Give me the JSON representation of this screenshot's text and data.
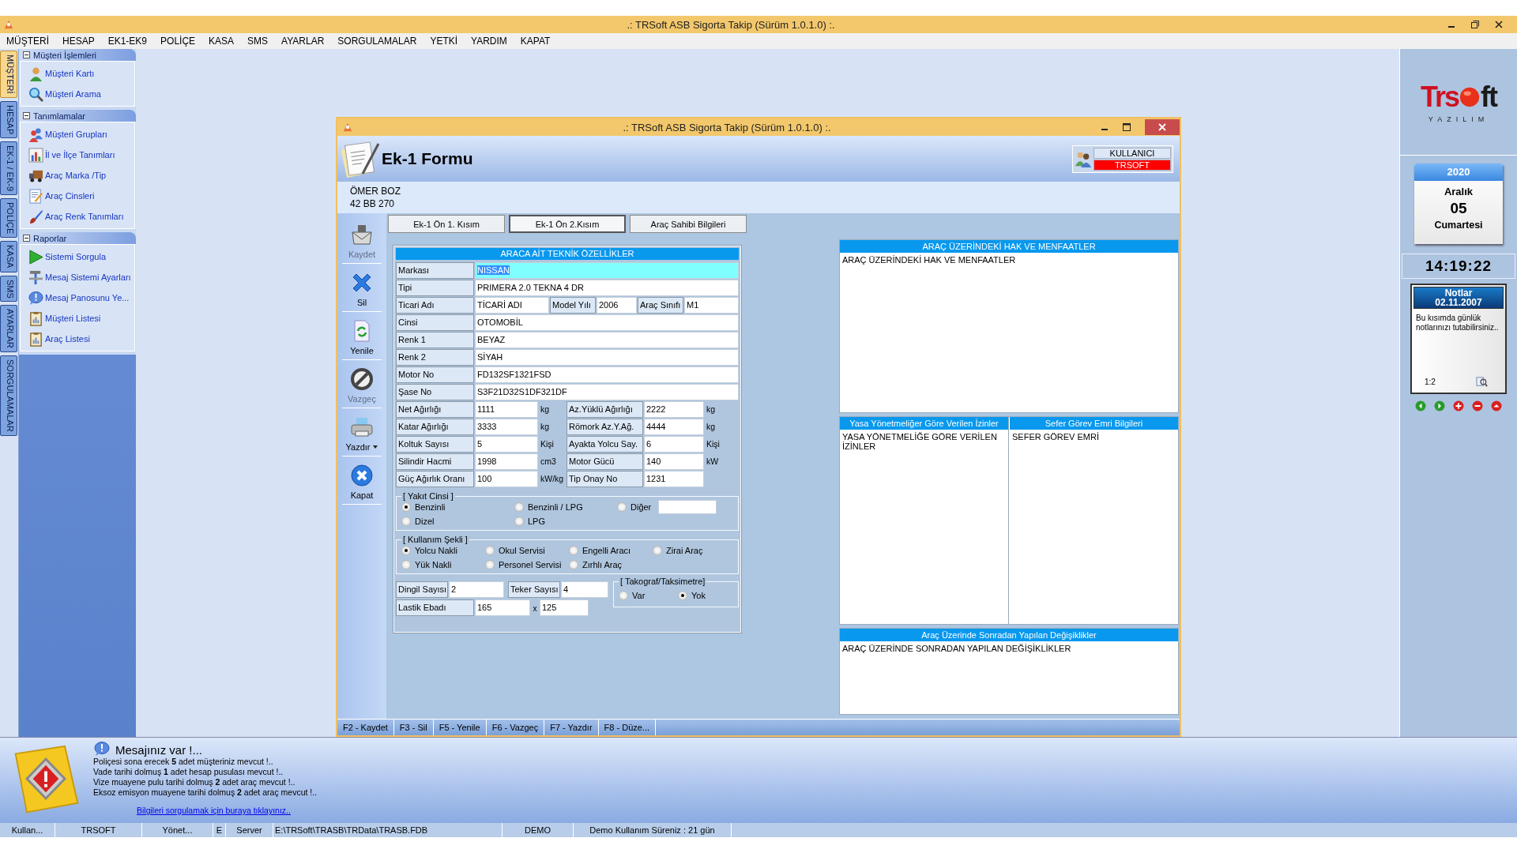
{
  "app_title": ".: TRSoft ASB Sigorta Takip (Sürüm 1.0.1.0) :.",
  "menu": [
    {
      "label": "MÜŞTERİ"
    },
    {
      "label": "HESAP"
    },
    {
      "label": "EK1-EK9"
    },
    {
      "label": "POLİÇE"
    },
    {
      "label": "KASA"
    },
    {
      "label": "SMS"
    },
    {
      "label": "AYARLAR"
    },
    {
      "label": "SORGULAMALAR"
    },
    {
      "label": "YETKİ"
    },
    {
      "label": "YARDIM"
    },
    {
      "label": "KAPAT"
    }
  ],
  "side_tabs": [
    {
      "label": "MÜŞTERİ",
      "selected": true
    },
    {
      "label": "HESAP",
      "selected": false
    },
    {
      "label": "EK-1 / EK-9",
      "selected": false
    },
    {
      "label": "POLİÇE",
      "selected": false
    },
    {
      "label": "KASA",
      "selected": false
    },
    {
      "label": "SMS",
      "selected": false
    },
    {
      "label": "AYARLAR",
      "selected": false
    },
    {
      "label": "SORGULAMALAR",
      "selected": false
    }
  ],
  "sidebar": [
    {
      "title": "Müşteri İşlemleri",
      "expanded": true,
      "items": [
        {
          "label": "Müşteri Kartı"
        },
        {
          "label": "Müşteri Arama"
        }
      ]
    },
    {
      "title": "Tanımlamalar",
      "expanded": true,
      "items": [
        {
          "label": "Müşteri Grupları"
        },
        {
          "label": "İl ve İlçe Tanımları"
        },
        {
          "label": "Araç Marka /Tip"
        },
        {
          "label": "Araç Cinsleri"
        },
        {
          "label": "Araç Renk Tanımları"
        }
      ]
    },
    {
      "title": "Raporlar",
      "expanded": true,
      "items": [
        {
          "label": "Sistemi Sorgula"
        },
        {
          "label": "Mesaj Sistemi Ayarları"
        },
        {
          "label": "Mesaj Panosunu Ye..."
        },
        {
          "label": "Müşteri Listesi"
        },
        {
          "label": "Araç Listesi"
        }
      ]
    }
  ],
  "form_window": {
    "title": ".: TRSoft ASB Sigorta Takip (Sürüm 1.0.1.0) :.",
    "heading": "Ek-1 Formu",
    "user_label": "KULLANICI",
    "user_name": "TRSOFT",
    "customer": {
      "name": "ÖMER BOZ",
      "plate": "42 BB 270"
    },
    "toolbar": [
      {
        "label": "Kaydet",
        "disabled": true,
        "has_menu": false
      },
      {
        "label": "Sil",
        "disabled": false,
        "has_menu": false
      },
      {
        "label": "Yenile",
        "disabled": false,
        "has_menu": false
      },
      {
        "label": "Vazgeç",
        "disabled": true,
        "has_menu": false
      },
      {
        "label": "Yazdır",
        "disabled": false,
        "has_menu": true
      },
      {
        "label": "Kapat",
        "disabled": false,
        "has_menu": false
      }
    ],
    "tabs": [
      {
        "label": "Ek-1 Ön 1. Kısım",
        "selected": false
      },
      {
        "label": "Ek-1 Ön 2.Kısım",
        "selected": true
      },
      {
        "label": "Araç Sahibi Bilgileri",
        "selected": false
      }
    ],
    "section_title": "ARACA AİT TEKNİK ÖZELLİKLER",
    "rows": [
      [
        {
          "label": "Markası",
          "value": "NISSAN",
          "focused": true
        }
      ],
      [
        {
          "label": "Tipi",
          "value": "PRIMERA 2.0 TEKNA 4 DR",
          "focused": false
        }
      ],
      [
        {
          "label": "Ticari Adı",
          "value": "TİCARİ ADI",
          "focused": false
        },
        {
          "label": "Model Yılı",
          "value": "2006",
          "focused": false
        },
        {
          "label": "Araç Sınıfı",
          "value": "M1",
          "focused": false
        }
      ],
      [
        {
          "label": "Cinsi",
          "value": "OTOMOBİL",
          "focused": false
        }
      ],
      [
        {
          "label": "Renk 1",
          "value": "BEYAZ",
          "focused": false
        }
      ],
      [
        {
          "label": "Renk 2",
          "value": "SİYAH",
          "focused": false
        }
      ],
      [
        {
          "label": "Motor No",
          "value": "FD132SF1321FSD",
          "focused": false
        }
      ],
      [
        {
          "label": "Şase No",
          "value": "S3F21D32S1DF321DF",
          "focused": false
        }
      ],
      [
        {
          "label": "Net Ağırlığı",
          "value": "1111",
          "unit": "kg",
          "focused": false
        },
        {
          "label": "Az.Yüklü Ağırlığı",
          "value": "2222",
          "unit": "kg",
          "focused": false
        }
      ],
      [
        {
          "label": "Katar Ağırlığı",
          "value": "3333",
          "unit": "kg",
          "focused": false
        },
        {
          "label": "Römork Az.Y.Ağ.",
          "value": "4444",
          "unit": "kg",
          "focused": false
        }
      ],
      [
        {
          "label": "Koltuk Sayısı",
          "value": "5",
          "unit": "Kişi",
          "focused": false
        },
        {
          "label": "Ayakta Yolcu Say.",
          "value": "6",
          "unit": "Kişi",
          "focused": false
        }
      ],
      [
        {
          "label": "Silindir Hacmi",
          "value": "1998",
          "unit": "cm3",
          "focused": false
        },
        {
          "label": "Motor Gücü",
          "value": "140",
          "unit": "kW",
          "focused": false
        }
      ],
      [
        {
          "label": "Güç Ağırlık Oranı",
          "value": "100",
          "unit": "kW/kg",
          "focused": false
        },
        {
          "label": "Tip Onay No",
          "value": "1231",
          "focused": false
        }
      ]
    ],
    "fuel": {
      "title": "[ Yakıt Cinsi ]",
      "options": [
        {
          "label": "Benzinli",
          "selected": true,
          "kind": "radio"
        },
        {
          "label": "Benzinli / LPG",
          "selected": false,
          "kind": "radio"
        },
        {
          "label": "Diğer",
          "selected": false,
          "kind": "radio_with_field"
        },
        {
          "label": "Dizel",
          "selected": false,
          "kind": "radio"
        },
        {
          "label": "LPG",
          "selected": false,
          "kind": "radio"
        }
      ]
    },
    "usage": {
      "title": "[ Kullanım Şekli ]",
      "options": [
        {
          "label": "Yolcu Nakli",
          "selected": true
        },
        {
          "label": "Okul Servisi",
          "selected": false
        },
        {
          "label": "Engelli Aracı",
          "selected": false
        },
        {
          "label": "Zirai Araç",
          "selected": false
        },
        {
          "label": "Yük Nakli",
          "selected": false
        },
        {
          "label": "Personel Servisi",
          "selected": false
        },
        {
          "label": "Zırhlı Araç",
          "selected": false
        }
      ]
    },
    "axles": {
      "label": "Dingil Sayısı",
      "value": "2"
    },
    "wheels": {
      "label": "Teker Sayısı",
      "value": "4"
    },
    "tire": {
      "label": "Lastik Ebadı",
      "value": "165",
      "separator": "x",
      "value2": "125"
    },
    "tachograph": {
      "title": "[ Takograf/Taksimetre]",
      "options": [
        {
          "label": "Var",
          "selected": false
        },
        {
          "label": "Yok",
          "selected": true
        }
      ]
    },
    "rights": {
      "title": "ARAÇ ÜZERİNDEKİ HAK VE MENFAATLER",
      "text": "ARAÇ ÜZERİNDEKİ HAK VE MENFAATLER"
    },
    "permits": {
      "title": "Yasa Yönetmeliğer Göre Verilen İzinler",
      "text": "YASA YÖNETMELİĞE GÖRE VERİLEN İZİNLER"
    },
    "trip": {
      "title": "Sefer Görev Emri Bilgileri",
      "text": "SEFER GÖREV EMRİ"
    },
    "changes": {
      "title": "Araç Üzerinde Sonradan Yapılan Değişiklikler",
      "text": "ARAÇ ÜZERİNDE SONRADAN YAPILAN DEĞİŞİKLİKLER"
    },
    "fkeys": [
      {
        "label": "F2 - Kaydet"
      },
      {
        "label": "F3 - Sil"
      },
      {
        "label": "F5 - Yenile"
      },
      {
        "label": "F6 - Vazgeç"
      },
      {
        "label": "F7 - Yazdır"
      },
      {
        "label": "F8 - Düze..."
      }
    ]
  },
  "widgets": {
    "logo": {
      "text_before": "Trs",
      "text_after": "ft",
      "tagline": "YAZILIM"
    },
    "calendar": {
      "year": "2020",
      "month": "Aralık",
      "day": "05",
      "weekday": "Cumartesi"
    },
    "clock": "14:19:22",
    "notes": {
      "title": "Notlar",
      "date": "02.11.2007",
      "text": "Bu kısımda günlük notlarınızı tutabilirsiniz..",
      "page": "1:2"
    }
  },
  "messages": {
    "title": "Mesajınız var !...",
    "lines": [
      "Poliçesi sona erecek **5** adet müşteriniz mevcut !..",
      "Vade tarihi dolmuş **1** adet hesap pusulası mevcut !..",
      "Vize muayene pulu tarihi dolmuş **2** adet araç mevcut !..",
      "Eksoz emisyon muayene tarihi dolmuş **2** adet araç mevcut !.."
    ],
    "link": "Bilgileri sorgulamak için buraya tıklayınız.."
  },
  "status_bar": [
    "Kullan...",
    "TRSOFT",
    "Yönet...",
    "E",
    "Server",
    "E:\\TRSoft\\TRASB\\TRData\\TRASB.FDB",
    "DEMO",
    "Demo Kullanım Süreniz : 21 gün"
  ]
}
